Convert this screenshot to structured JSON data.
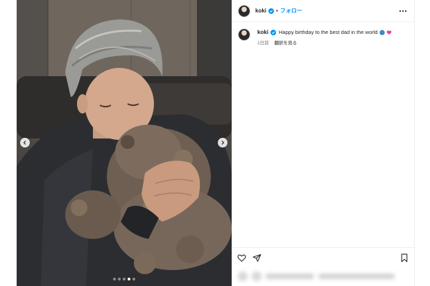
{
  "post": {
    "username": "koki",
    "follow_label": "フォロー",
    "separator": "•",
    "caption": "Happy birthday to the best dad in the world",
    "time_ago": "1日前",
    "translate_label": "翻訳を見る"
  },
  "carousel": {
    "total_slides": 5,
    "active_slide": 4
  },
  "colors": {
    "accent": "#0095f6",
    "text": "#262626",
    "secondary": "#737373",
    "border": "#efefef"
  },
  "icons": [
    "verified-badge-icon",
    "more-options-icon",
    "globe-emoji-icon",
    "heart-emoji-icon",
    "chevron-left-icon",
    "chevron-right-icon",
    "heart-icon",
    "send-icon",
    "bookmark-icon"
  ]
}
